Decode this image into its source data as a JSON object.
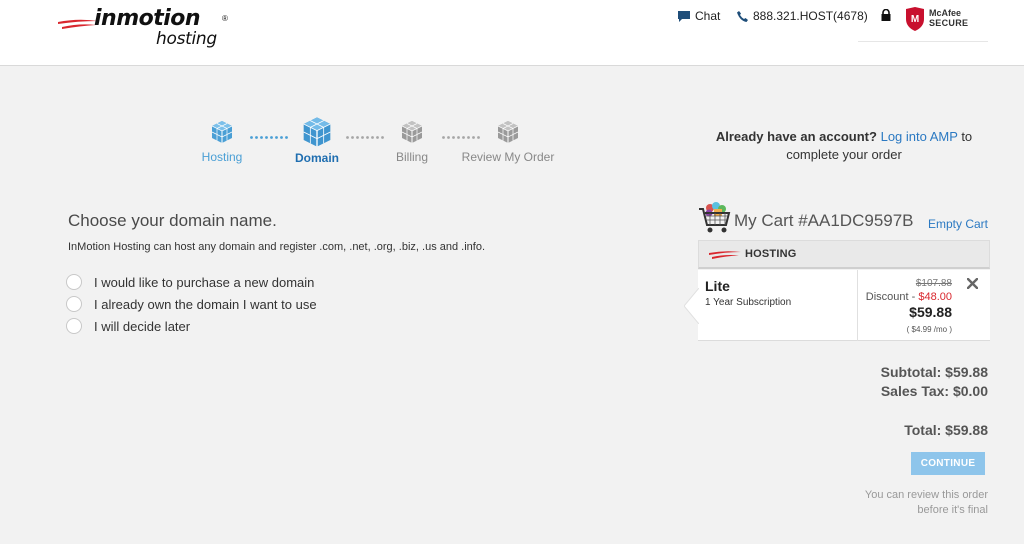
{
  "header": {
    "logo_main": "inmotion",
    "logo_registered": "®",
    "logo_sub": "hosting",
    "chat_label": "Chat",
    "phone_label": "888.321.HOST(4678)",
    "mcafee_line1": "McAfee",
    "mcafee_line2": "SECURE"
  },
  "steps": [
    {
      "label": "Hosting",
      "state": "done"
    },
    {
      "label": "Domain",
      "state": "active"
    },
    {
      "label": "Billing",
      "state": "pending"
    },
    {
      "label": "Review My Order",
      "state": "pending"
    }
  ],
  "domain": {
    "title": "Choose your domain name.",
    "description": "InMotion Hosting can host any domain and register .com, .net, .org, .biz, .us and .info.",
    "options": [
      "I would like to purchase a new domain",
      "I already own the domain I want to use",
      "I will decide later"
    ]
  },
  "account": {
    "prompt": "Already have an account?",
    "link": "Log into AMP",
    "suffix": "to",
    "line2": "complete your order"
  },
  "cart": {
    "title": "My Cart #AA1DC9597B",
    "empty_label": "Empty Cart",
    "section_label": "HOSTING",
    "item": {
      "name": "Lite",
      "term": "1 Year Subscription",
      "old_price": "$107.88",
      "discount_label": "Discount -",
      "discount_value": "$48.00",
      "price": "$59.88",
      "per_month": "( $4.99 /mo )"
    },
    "subtotal": "Subtotal: $59.88",
    "sales_tax": "Sales Tax: $0.00",
    "total": "Total: $59.88",
    "continue_label": "CONTINUE",
    "review_note_1": "You can review this order",
    "review_note_2": "before it's final"
  },
  "colors": {
    "accent": "#2b79c2",
    "step_active": "#4a9fd5",
    "step_pending": "#a6a6a6",
    "discount_red": "#d9272e",
    "continue_bg": "#8ec5eb",
    "brand_red": "#d9272e"
  }
}
